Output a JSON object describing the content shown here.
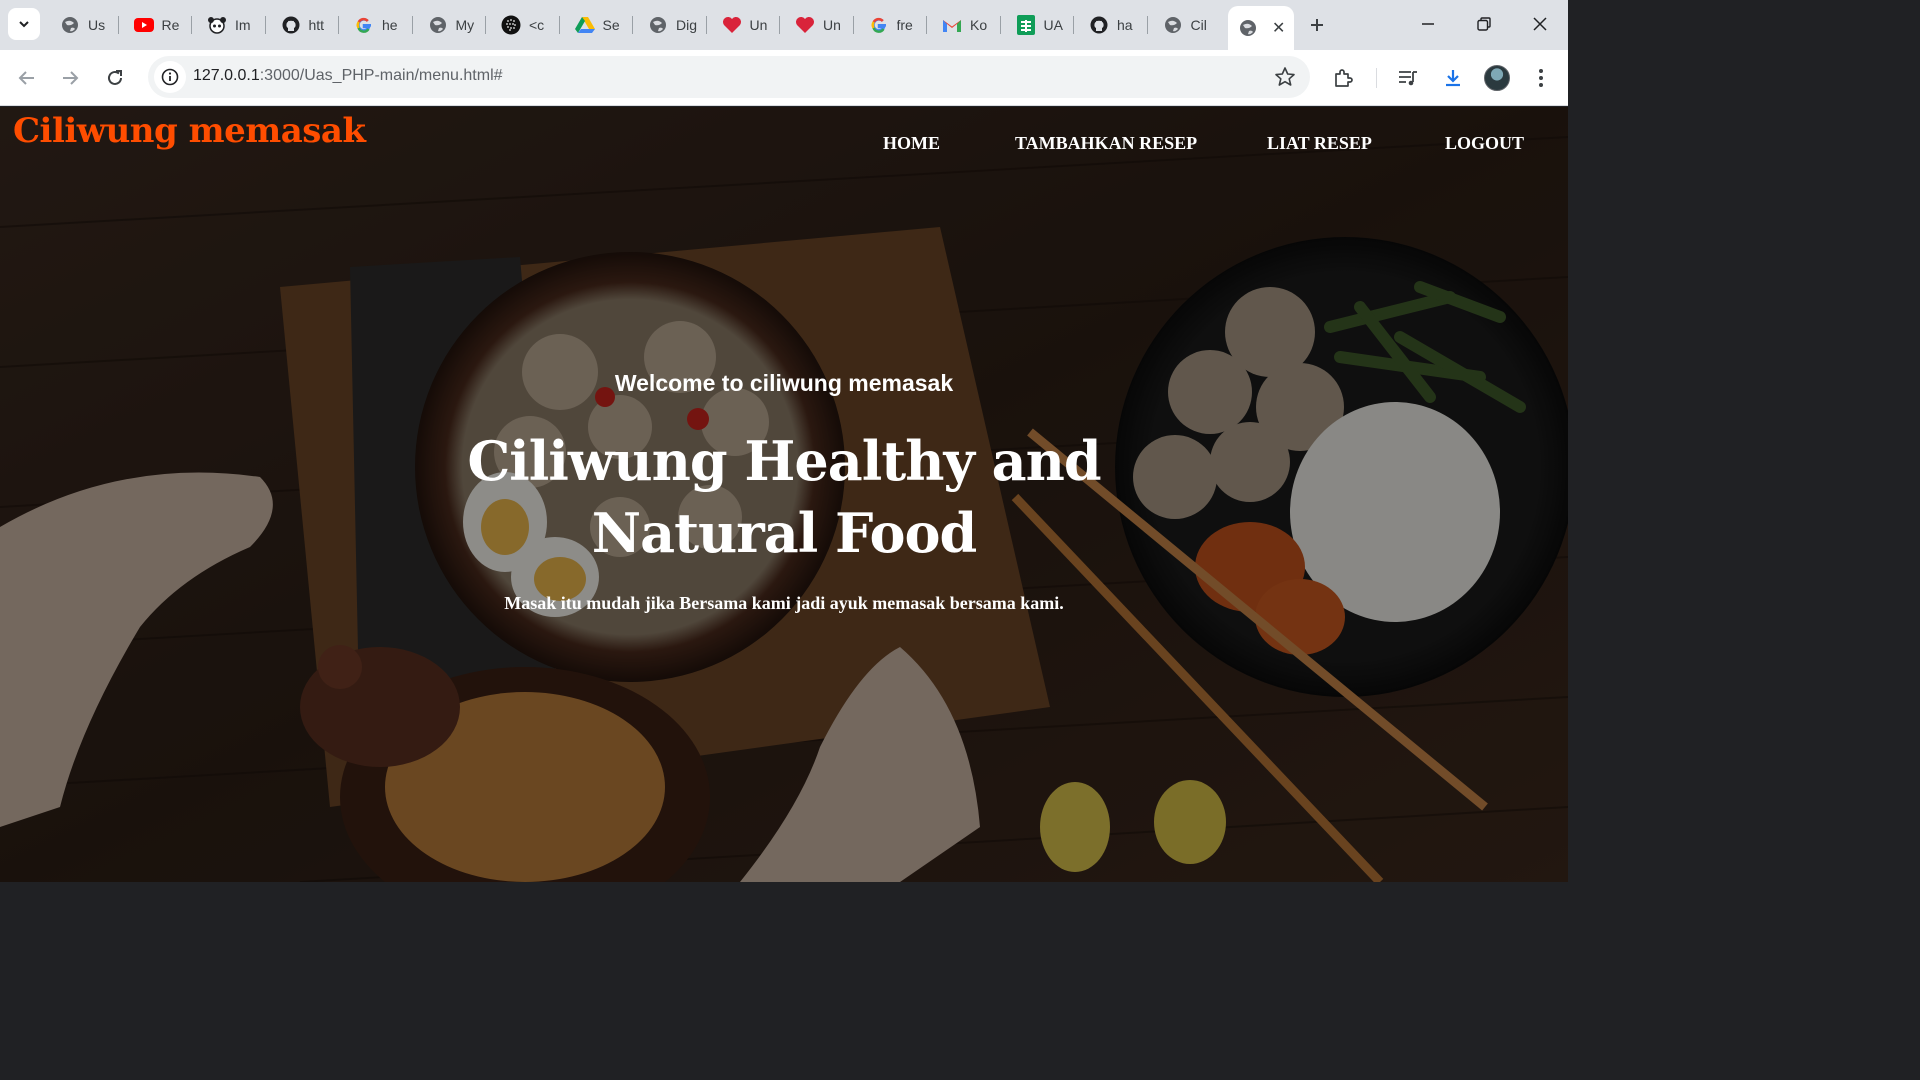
{
  "browser": {
    "tabs": [
      {
        "title": "Us",
        "icon": "globe-icon"
      },
      {
        "title": "Re",
        "icon": "youtube-icon"
      },
      {
        "title": "Im",
        "icon": "panda-icon"
      },
      {
        "title": "htt",
        "icon": "github-icon"
      },
      {
        "title": "he",
        "icon": "google-icon"
      },
      {
        "title": "My",
        "icon": "globe-icon"
      },
      {
        "title": "<c",
        "icon": "dots-icon"
      },
      {
        "title": "Se",
        "icon": "drive-icon"
      },
      {
        "title": "Dig",
        "icon": "globe-icon"
      },
      {
        "title": "Un",
        "icon": "heart-icon"
      },
      {
        "title": "Un",
        "icon": "heart-icon"
      },
      {
        "title": "fre",
        "icon": "google-icon"
      },
      {
        "title": "Ko",
        "icon": "gmail-icon"
      },
      {
        "title": "UA",
        "icon": "sheets-icon"
      },
      {
        "title": "ha",
        "icon": "github-icon"
      },
      {
        "title": "Cil",
        "icon": "globe-icon"
      }
    ],
    "active_tab_icon": "globe-icon",
    "url_host": "127.0.0.1",
    "url_rest": ":3000/Uas_PHP-main/menu.html#"
  },
  "site": {
    "brand": "Ciliwung memasak",
    "nav": [
      "HOME",
      "TAMBAHKAN RESEP",
      "LIAT RESEP",
      "LOGOUT"
    ]
  },
  "hero": {
    "kicker": "Welcome to ciliwung memasak",
    "title_line1": "Ciliwung Healthy and",
    "title_line2": "Natural Food",
    "subtitle": "Masak itu mudah jika Bersama kami jadi ayuk memasak bersama kami."
  },
  "colors": {
    "brand": "#ff4d00",
    "tabstrip": "#dee1e6",
    "omnibox": "#f1f3f4"
  }
}
